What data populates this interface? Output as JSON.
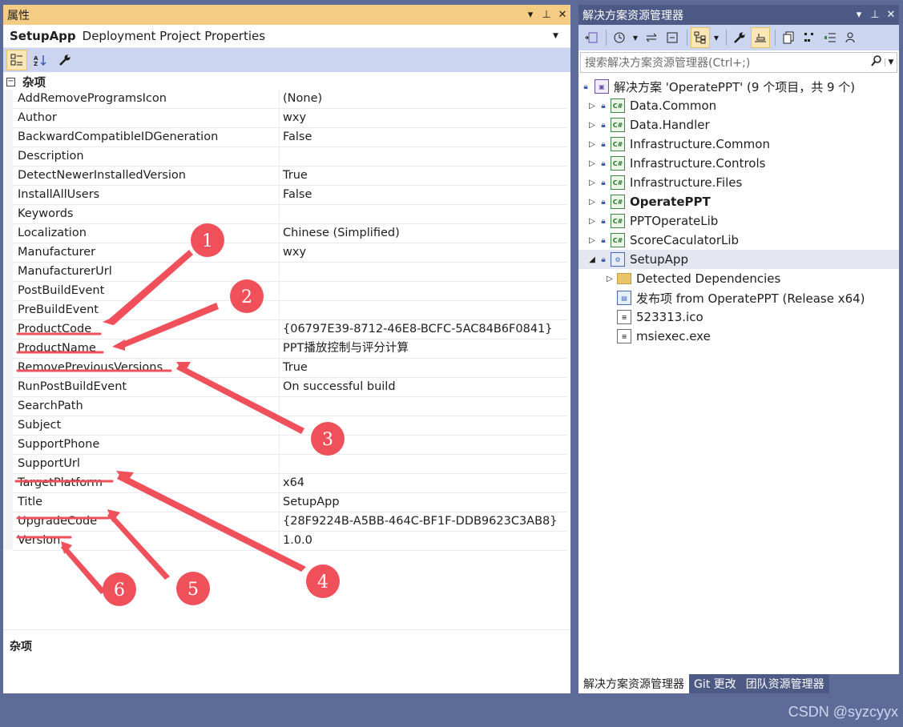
{
  "properties": {
    "title": "属性",
    "title_controls": [
      "▾",
      "⊥",
      "✕"
    ],
    "object_name": "SetupApp",
    "object_desc": "Deployment Project Properties",
    "toolbar": [
      "categorized-icon",
      "alphabetical-icon",
      "property-pages-icon"
    ],
    "category": "杂项",
    "rows": [
      {
        "name": "AddRemoveProgramsIcon",
        "value": "(None)"
      },
      {
        "name": "Author",
        "value": "wxy"
      },
      {
        "name": "BackwardCompatibleIDGeneration",
        "value": "False"
      },
      {
        "name": "Description",
        "value": ""
      },
      {
        "name": "DetectNewerInstalledVersion",
        "value": "True"
      },
      {
        "name": "InstallAllUsers",
        "value": "False"
      },
      {
        "name": "Keywords",
        "value": ""
      },
      {
        "name": "Localization",
        "value": "Chinese (Simplified)"
      },
      {
        "name": "Manufacturer",
        "value": "wxy"
      },
      {
        "name": "ManufacturerUrl",
        "value": ""
      },
      {
        "name": "PostBuildEvent",
        "value": ""
      },
      {
        "name": "PreBuildEvent",
        "value": ""
      },
      {
        "name": "ProductCode",
        "value": "{06797E39-8712-46E8-BCFC-5AC84B6F0841}"
      },
      {
        "name": "ProductName",
        "value": "PPT播放控制与评分计算"
      },
      {
        "name": "RemovePreviousVersions",
        "value": "True"
      },
      {
        "name": "RunPostBuildEvent",
        "value": "On successful build"
      },
      {
        "name": "SearchPath",
        "value": ""
      },
      {
        "name": "Subject",
        "value": ""
      },
      {
        "name": "SupportPhone",
        "value": ""
      },
      {
        "name": "SupportUrl",
        "value": ""
      },
      {
        "name": "TargetPlatform",
        "value": "x64"
      },
      {
        "name": "Title",
        "value": "SetupApp"
      },
      {
        "name": "UpgradeCode",
        "value": "{28F9224B-A5BB-464C-BF1F-DDB9623C3AB8}"
      },
      {
        "name": "Version",
        "value": "1.0.0"
      }
    ],
    "description_title": "杂项"
  },
  "solution_explorer": {
    "title": "解决方案资源管理器",
    "title_controls": [
      "▾",
      "⊥",
      "✕"
    ],
    "search_placeholder": "搜索解决方案资源管理器(Ctrl+;)",
    "solution": "解决方案 'OperatePPT' (9 个项目，共 9 个)",
    "projects": [
      {
        "label": "Data.Common",
        "bold": false
      },
      {
        "label": "Data.Handler",
        "bold": false
      },
      {
        "label": "Infrastructure.Common",
        "bold": false
      },
      {
        "label": "Infrastructure.Controls",
        "bold": false
      },
      {
        "label": "Infrastructure.Files",
        "bold": false
      },
      {
        "label": "OperatePPT",
        "bold": true
      },
      {
        "label": "PPTOperateLib",
        "bold": false
      },
      {
        "label": "ScoreCaculatorLib",
        "bold": false
      }
    ],
    "setup_project": "SetupApp",
    "setup_children": [
      {
        "label": "Detected Dependencies",
        "icon": "folder"
      },
      {
        "label": "发布项 from OperatePPT (Release x64)",
        "icon": "output"
      },
      {
        "label": "523313.ico",
        "icon": "file"
      },
      {
        "label": "msiexec.exe",
        "icon": "file"
      }
    ],
    "tabs": [
      "解决方案资源管理器",
      "Git 更改",
      "团队资源管理器"
    ],
    "active_tab": 0
  },
  "annotations": {
    "badges": [
      "1",
      "2",
      "3",
      "4",
      "5",
      "6"
    ],
    "accent": "#f0505a"
  },
  "watermark": "CSDN @syzcyyx"
}
